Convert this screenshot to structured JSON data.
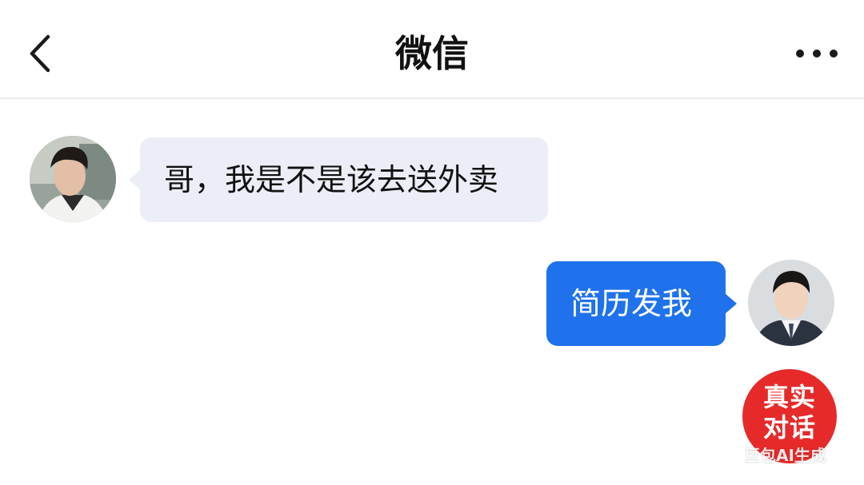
{
  "header": {
    "title": "微信",
    "back_icon": "chevron-left-icon",
    "more_icon": "more-horizontal-icon"
  },
  "messages": [
    {
      "sender": "other",
      "text": "哥，我是不是该去送外卖"
    },
    {
      "sender": "self",
      "text": "简历发我"
    }
  ],
  "badge": {
    "line1": "真实",
    "line2": "对话"
  },
  "watermark": "豆包AI生成",
  "colors": {
    "incoming_bubble": "#eceef7",
    "outgoing_bubble": "#1f72eb",
    "badge": "#e62a2a"
  }
}
